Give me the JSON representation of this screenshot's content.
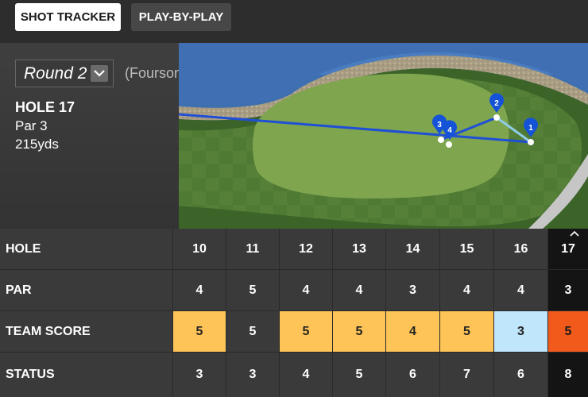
{
  "tabs": [
    {
      "label": "SHOT TRACKER",
      "active": true
    },
    {
      "label": "PLAY-BY-PLAY",
      "active": false
    }
  ],
  "info": {
    "round_selected": "Round 2",
    "format": "(Foursomes)",
    "hole_title": "HOLE 17",
    "par": "Par 3",
    "yardage": "215yds"
  },
  "map": {
    "shots": [
      "1",
      "2",
      "3",
      "4"
    ]
  },
  "scorecard": {
    "rows": {
      "hole": "HOLE",
      "par": "PAR",
      "team_score": "TEAM SCORE",
      "status": "STATUS"
    },
    "holes": [
      "10",
      "11",
      "12",
      "13",
      "14",
      "15",
      "16",
      "17"
    ],
    "pars": [
      "4",
      "5",
      "4",
      "4",
      "3",
      "4",
      "4",
      "3"
    ],
    "team_scores": [
      "5",
      "5",
      "5",
      "5",
      "4",
      "5",
      "3",
      "5"
    ],
    "statuses": [
      "3",
      "3",
      "4",
      "5",
      "6",
      "7",
      "6",
      "8"
    ],
    "current_hole": "17"
  },
  "colors": {
    "bogey": "#ffc457",
    "par": "#3a3a3a",
    "birdie": "#bfe6fb",
    "double_bogey": "#f25a1c",
    "shot_pin": "#1453d8",
    "shot_line": "#1f4fd6"
  }
}
